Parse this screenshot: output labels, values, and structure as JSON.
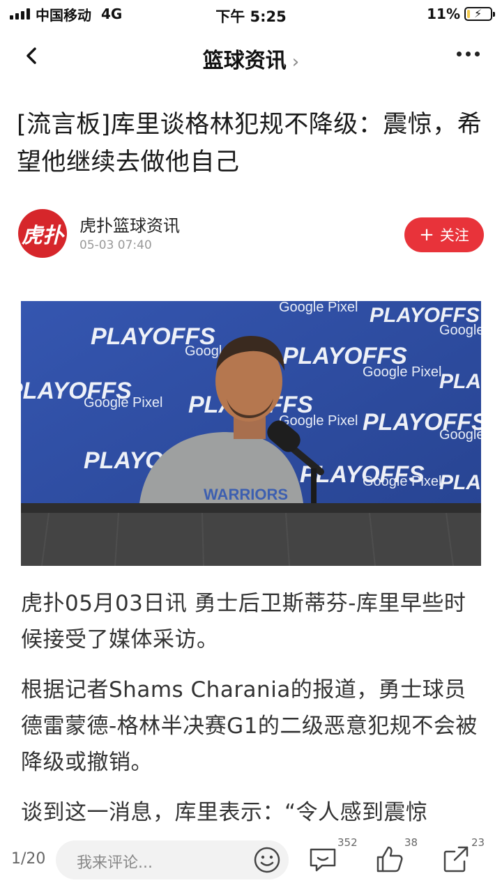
{
  "status_bar": {
    "carrier": "中国移动",
    "network": "4G",
    "time": "下午 5:25",
    "battery_percent": "11%",
    "battery_level": 0.11
  },
  "nav": {
    "title": "篮球资讯",
    "title_chevron": "›"
  },
  "article": {
    "headline": "[流言板]库里谈格林犯规不降级：震惊，希望他继续去做他自己",
    "author": {
      "avatar_text": "虎扑",
      "name": "虎扑篮球资讯",
      "time": "05-03 07:40",
      "follow_label": "关注",
      "follow_plus": "+"
    },
    "photo": {
      "backdrop_text": [
        "PLAYOFFS",
        "Google Pixel"
      ],
      "jersey_text": "WARRIORS"
    },
    "paragraphs": [
      "虎扑05月03日讯 勇士后卫斯蒂芬-库里早些时候接受了媒体采访。",
      "根据记者Shams Charania的报道，勇士球员德雷蒙德-格林半决赛G1的二级恶意犯规不会被降级或撤销。",
      "谈到这一消息，库里表示：“令人感到震惊"
    ]
  },
  "bottom_bar": {
    "page_indicator": "1/20",
    "comment_placeholder": "我来评论...",
    "comments_count": "352",
    "likes_count": "38",
    "shares_count": "23"
  },
  "colors": {
    "accent_red": "#e8333a",
    "avatar_red": "#d6262b",
    "photo_backdrop": "#2b4a9c"
  },
  "icons": [
    "back-arrow-icon",
    "more-dots-icon",
    "emoji-icon",
    "comment-icon",
    "like-icon",
    "share-icon"
  ]
}
